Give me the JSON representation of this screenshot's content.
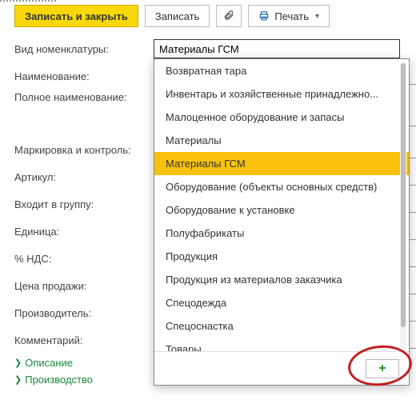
{
  "toolbar": {
    "save_close": "Записать и закрыть",
    "save": "Записать",
    "print": "Печать"
  },
  "labels": {
    "kind": "Вид номенклатуры:",
    "name": "Наименование:",
    "full_name": "Полное наименование:",
    "marking": "Маркировка и контроль:",
    "article": "Артикул:",
    "group": "Входит в группу:",
    "unit": "Единица:",
    "vat": "% НДС:",
    "sale_price": "Цена продажи:",
    "producer": "Производитель:",
    "comment": "Комментарий:"
  },
  "kind_value": "Материалы ГСМ",
  "dropdown": {
    "items": [
      "Возвратная тара",
      "Инвентарь и хозяйственные принадлежно...",
      "Малоценное оборудование и запасы",
      "Материалы",
      "Материалы ГСМ",
      "Оборудование (объекты основных средств)",
      "Оборудование к установке",
      "Полуфабрикаты",
      "Продукция",
      "Продукция из материалов заказчика",
      "Спецодежда",
      "Спецоснастка",
      "Товары"
    ],
    "selected_index": 4,
    "add_label": "+"
  },
  "expanders": {
    "description": "Описание",
    "production": "Производство"
  }
}
